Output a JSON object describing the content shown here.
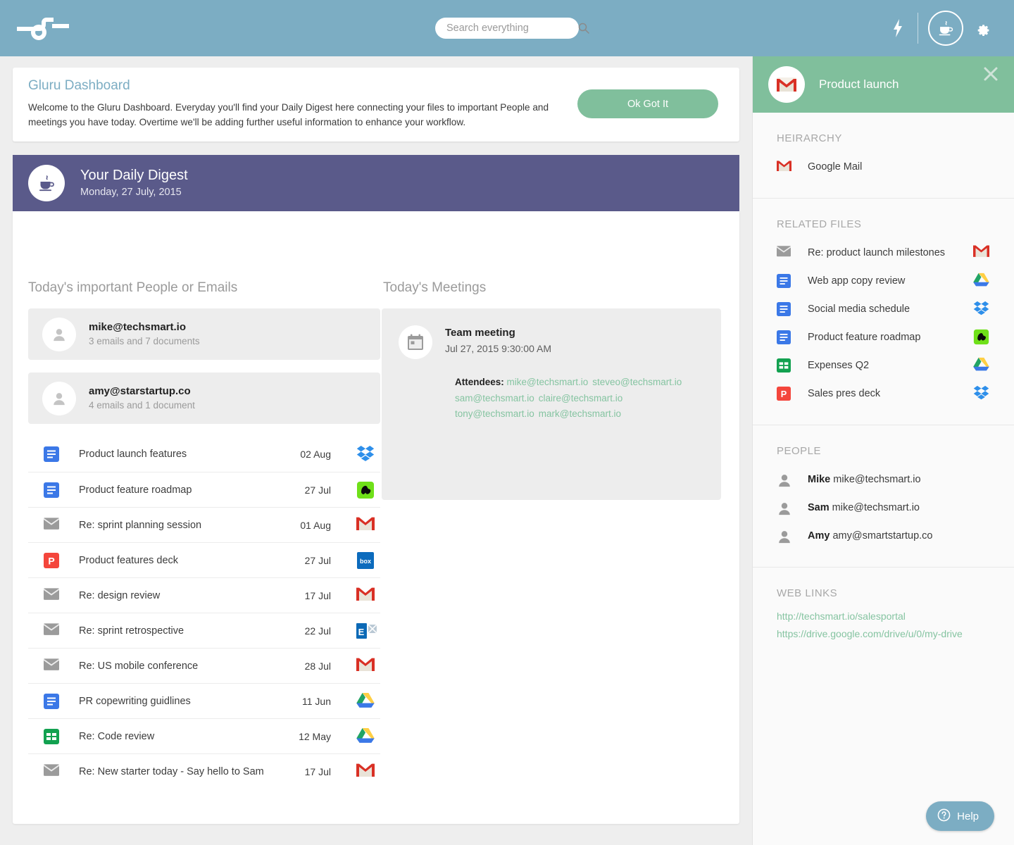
{
  "header": {
    "logo_name": "gluru-logo",
    "search": {
      "placeholder": "Search everything",
      "value": ""
    },
    "bolt_icon": "lightning-bolt-icon",
    "cup_icon": "coffee-cup-icon",
    "gear_icon": "gear-icon"
  },
  "welcome": {
    "title": "Gluru Dashboard",
    "body": "Welcome to the Gluru Dashboard. Everyday you'll find your Daily Digest here connecting your files to important People and meetings you have today. Overtime we'll be adding further useful information to enhance your workflow.",
    "button": "Ok Got It"
  },
  "digest": {
    "title": "Your Daily Digest",
    "date": "Monday, 27 July, 2015",
    "icon": "coffee-cup-icon"
  },
  "people_section": {
    "heading": "Today's important People or Emails",
    "people": [
      {
        "email": "mike@techsmart.io",
        "sub": "3 emails and 7 documents"
      },
      {
        "email": "amy@starstartup.co",
        "sub": "4 emails and 1 document"
      }
    ],
    "files": [
      {
        "name": "Product launch features",
        "date": "02 Aug",
        "type": "doc",
        "source": "dropbox"
      },
      {
        "name": "Product feature roadmap",
        "date": "27 Jul",
        "type": "doc",
        "source": "evernote"
      },
      {
        "name": "Re: sprint planning session",
        "date": "01 Aug",
        "type": "mail",
        "source": "gmail"
      },
      {
        "name": "Product features deck",
        "date": "27 Jul",
        "type": "ppt",
        "source": "box"
      },
      {
        "name": "Re: design review",
        "date": "17 Jul",
        "type": "mail",
        "source": "gmail"
      },
      {
        "name": "Re: sprint retrospective",
        "date": "22 Jul",
        "type": "mail",
        "source": "exchange"
      },
      {
        "name": "Re: US mobile conference",
        "date": "28 Jul",
        "type": "mail",
        "source": "gmail"
      },
      {
        "name": "PR copewriting guidlines",
        "date": "11 Jun",
        "type": "doc",
        "source": "gdrive"
      },
      {
        "name": "Re: Code review",
        "date": "12 May",
        "type": "sheet",
        "source": "gdrive"
      },
      {
        "name": "Re: New starter today - Say hello to Sam",
        "date": "17 Jul",
        "type": "mail",
        "source": "gmail"
      }
    ]
  },
  "meetings_section": {
    "heading": "Today's Meetings",
    "meeting": {
      "title": "Team meeting",
      "time": "Jul 27, 2015 9:30:00 AM",
      "attendees_label": "Attendees:",
      "attendees": [
        "mike@techsmart.io",
        "steveo@techsmart.io",
        "sam@techsmart.io",
        "claire@techsmart.io",
        "tony@techsmart.io",
        "mark@techsmart.io"
      ],
      "icon": "calendar-icon"
    }
  },
  "sidebar": {
    "title": "Product launch",
    "title_icon": "gmail-icon",
    "close_icon": "close-icon",
    "hierarchy": {
      "label": "HEIRARCHY",
      "items": [
        {
          "name": "Google Mail",
          "icon": "gmail-icon"
        }
      ]
    },
    "related_files": {
      "label": "RELATED FILES",
      "items": [
        {
          "name": "Re: product launch milestones",
          "type": "mail",
          "source": "gmail"
        },
        {
          "name": "Web app copy review",
          "type": "doc",
          "source": "gdrive"
        },
        {
          "name": "Social media schedule",
          "type": "doc",
          "source": "dropbox"
        },
        {
          "name": "Product feature roadmap",
          "type": "doc",
          "source": "evernote"
        },
        {
          "name": "Expenses Q2",
          "type": "sheet",
          "source": "gdrive"
        },
        {
          "name": "Sales pres deck",
          "type": "ppt",
          "source": "dropbox"
        }
      ]
    },
    "people": {
      "label": "PEOPLE",
      "items": [
        {
          "name": "Mike",
          "email": "mike@techsmart.io"
        },
        {
          "name": "Sam",
          "email": "mike@techsmart.io"
        },
        {
          "name": "Amy",
          "email": "amy@smartstartup.co"
        }
      ]
    },
    "web_links": {
      "label": "WEB LINKS",
      "items": [
        "http://techsmart.io/salesportal",
        "https://drive.google.com/drive/u/0/my-drive"
      ]
    }
  },
  "help": {
    "label": "Help",
    "icon": "question-mark-icon"
  },
  "colors": {
    "header_blue": "#7cadc3",
    "digest_purple": "#5a5a8a",
    "accent_green": "#80bf9c",
    "link_green": "#85c4a1"
  }
}
